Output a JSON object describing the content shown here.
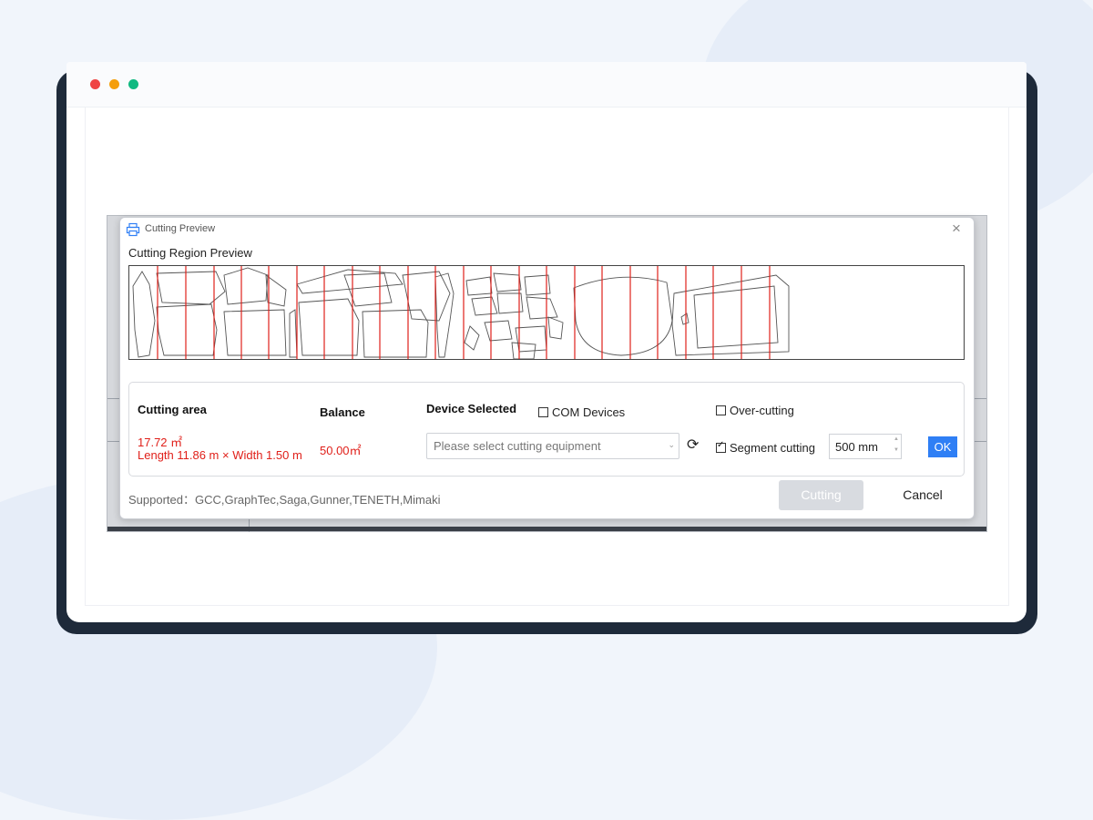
{
  "window": {
    "controls": [
      "close-dot",
      "minimize-dot",
      "maximize-dot"
    ],
    "colors": {
      "close": "#ef4444",
      "minimize": "#f59e0b",
      "maximize": "#10b981"
    }
  },
  "dialog": {
    "title": "Cutting Preview",
    "close_symbol": "×",
    "region_label": "Cutting Region Preview",
    "cutting_area": {
      "label": "Cutting area",
      "value": "17.72 ㎡",
      "dimensions": "Length 11.86 m × Width 1.50 m"
    },
    "balance": {
      "label": "Balance",
      "value": "50.00㎡"
    },
    "device": {
      "label": "Device Selected",
      "placeholder": "Please select cutting equipment"
    },
    "com_devices": {
      "label": "COM Devices",
      "checked": false
    },
    "over_cutting": {
      "label": "Over-cutting",
      "checked": false
    },
    "segment_cutting": {
      "label": "Segment cutting",
      "checked": true,
      "value": "500 mm"
    },
    "ok_label": "OK",
    "supported": "Supported：GCC,GraphTec,Saga,Gunner,TENETH,Mimaki",
    "cutting_button": "Cutting",
    "cancel_button": "Cancel"
  }
}
